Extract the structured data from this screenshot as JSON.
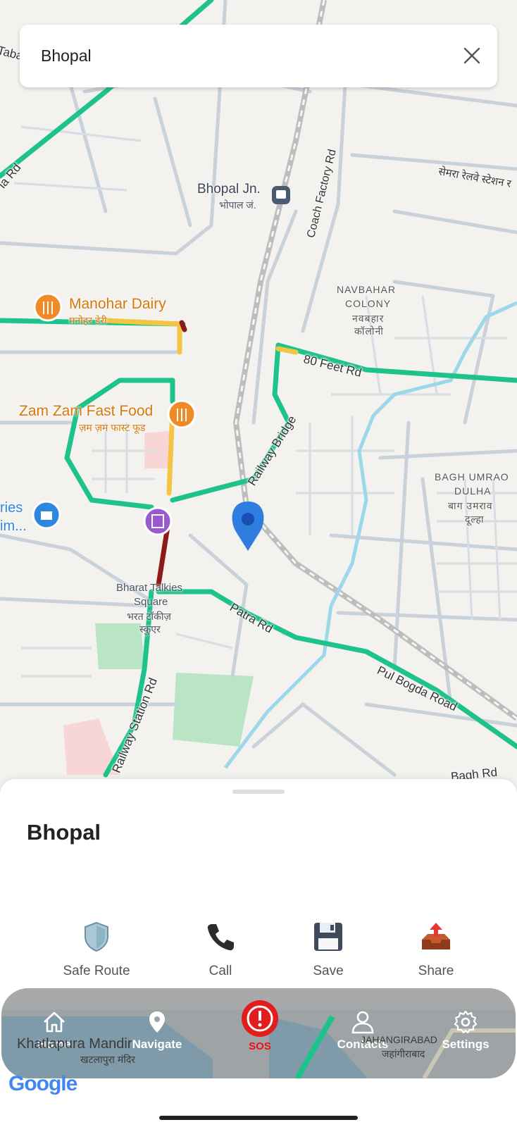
{
  "search": {
    "query": "Bhopal"
  },
  "map": {
    "labels": {
      "station_name": "Bhopal Jn.",
      "station_name_hi": "भोपाल जं.",
      "coach_factory_rd": "Coach Factory Rd",
      "semra_station": "सेमरा रेलवे स्टेशन र",
      "navbahar_1": "NAVBAHAR",
      "navbahar_2": "COLONY",
      "navbahar_hi_1": "नवबहार",
      "navbahar_hi_2": "कॉलोनी",
      "manohar_dairy": "Manohar Dairy",
      "manohar_dairy_hi": "मनोहर डेरी",
      "feet_rd": "80 Feet Rd",
      "zamzam": "Zam Zam Fast Food",
      "zamzam_hi": "ज़म ज़म फास्ट फूड",
      "railway_bridge": "Railway Bridge",
      "bagh_umrao_1": "BAGH UMRAO",
      "bagh_umrao_2": "DULHA",
      "bagh_umrao_hi_1": "बाग उमराव",
      "bagh_umrao_hi_2": "दूल्हा",
      "left_partial_1": "ries",
      "left_partial_2": "im...",
      "bharat_1": "Bharat Talkies",
      "bharat_2": "Square",
      "bharat_hi_1": "भरत टॉकीज़",
      "bharat_hi_2": "स्कुएर",
      "patra_rd": "Patra Rd",
      "pul_bogda": "Pul Bogda Road",
      "railway_station_rd": "Railway Station Rd",
      "bagh_rd": "Bagh Rd",
      "top_left_road": "la Rd",
      "top_left_road2": "Taba",
      "jahangirabad": "JAHANGIRABAD",
      "jahangirabad_hi": "जहांगीराबाद",
      "khatlapura": "Khatlapura Mandir",
      "khatlapura_hi": "खटलापुरा मंदिर",
      "google": "Google"
    }
  },
  "place": {
    "title": "Bhopal",
    "actions": [
      {
        "label": "Safe Route",
        "icon": "shield-icon"
      },
      {
        "label": "Call",
        "icon": "phone-icon"
      },
      {
        "label": "Save",
        "icon": "floppy-disk-icon"
      },
      {
        "label": "Share",
        "icon": "outbox-tray-icon"
      }
    ]
  },
  "nav": {
    "items": [
      {
        "label": "Home",
        "icon": "home-icon"
      },
      {
        "label": "Navigate",
        "icon": "location-pin-icon"
      },
      {
        "label": "SOS",
        "icon": "alert-icon"
      },
      {
        "label": "Contacts",
        "icon": "person-icon"
      },
      {
        "label": "Settings",
        "icon": "gear-icon"
      }
    ]
  },
  "colors": {
    "traffic_green": "#1ec28b",
    "traffic_yellow": "#f4c542",
    "traffic_red": "#8b1a1a",
    "pin_blue": "#2f7de1",
    "sos_red": "#e11d1d",
    "poi_orange": "#f08a24"
  }
}
